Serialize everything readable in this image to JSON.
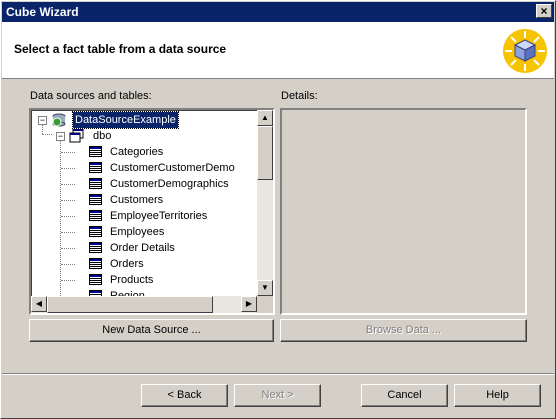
{
  "window": {
    "title": "Cube Wizard",
    "close_glyph": "×"
  },
  "header": {
    "heading": "Select a fact table from a data source",
    "icon": "cube-wizard-icon"
  },
  "sources": {
    "label": "Data sources and tables:",
    "tree": {
      "root": "DataSourceExample",
      "schema": "dbo",
      "tables": [
        "Categories",
        "CustomerCustomerDemo",
        "CustomerDemographics",
        "Customers",
        "EmployeeTerritories",
        "Employees",
        "Order Details",
        "Orders",
        "Products",
        "Region"
      ]
    }
  },
  "details": {
    "label": "Details:"
  },
  "buttons": {
    "new_data_source": "New Data Source ...",
    "browse_data": "Browse Data ...",
    "back": "< Back",
    "next": "Next >",
    "cancel": "Cancel",
    "help": "Help"
  },
  "colors": {
    "selection": "#0a246a",
    "titlebar": "#0a246a",
    "face": "#d4d0c8"
  }
}
